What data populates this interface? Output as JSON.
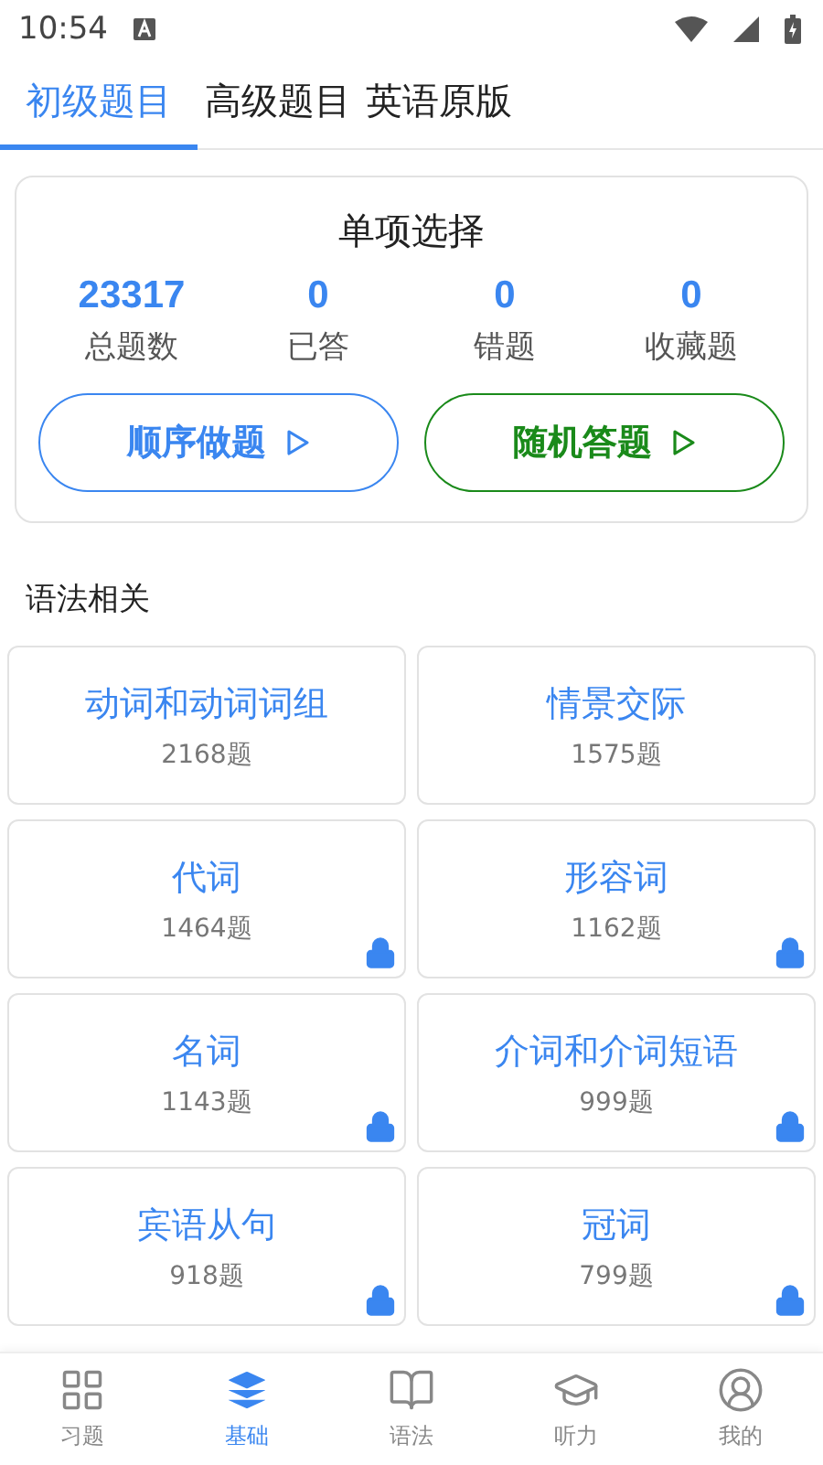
{
  "status_bar": {
    "time": "10:54"
  },
  "tabs": [
    {
      "label": "初级题目",
      "selected": true
    },
    {
      "label": "高级题目",
      "selected": false
    },
    {
      "label": "英语原版",
      "selected": false
    }
  ],
  "summary": {
    "title": "单项选择",
    "stats": [
      {
        "value": "23317",
        "label": "总题数"
      },
      {
        "value": "0",
        "label": "已答"
      },
      {
        "value": "0",
        "label": "错题"
      },
      {
        "value": "0",
        "label": "收藏题"
      }
    ],
    "buttons": [
      {
        "label": "顺序做题",
        "kind": "sequential"
      },
      {
        "label": "随机答题",
        "kind": "random"
      }
    ]
  },
  "section_title": "语法相关",
  "categories": [
    {
      "title": "动词和动词词组",
      "count": "2168题",
      "locked": false
    },
    {
      "title": "情景交际",
      "count": "1575题",
      "locked": false
    },
    {
      "title": "代词",
      "count": "1464题",
      "locked": true
    },
    {
      "title": "形容词",
      "count": "1162题",
      "locked": true
    },
    {
      "title": "名词",
      "count": "1143题",
      "locked": true
    },
    {
      "title": "介词和介词短语",
      "count": "999题",
      "locked": true
    },
    {
      "title": "宾语从句",
      "count": "918题",
      "locked": true
    },
    {
      "title": "冠词",
      "count": "799题",
      "locked": true
    }
  ],
  "bottom_nav": [
    {
      "label": "习题",
      "kind": "grid",
      "selected": false
    },
    {
      "label": "基础",
      "kind": "layers",
      "selected": true
    },
    {
      "label": "语法",
      "kind": "book",
      "selected": false
    },
    {
      "label": "听力",
      "kind": "cap",
      "selected": false
    },
    {
      "label": "我的",
      "kind": "user",
      "selected": false
    }
  ]
}
